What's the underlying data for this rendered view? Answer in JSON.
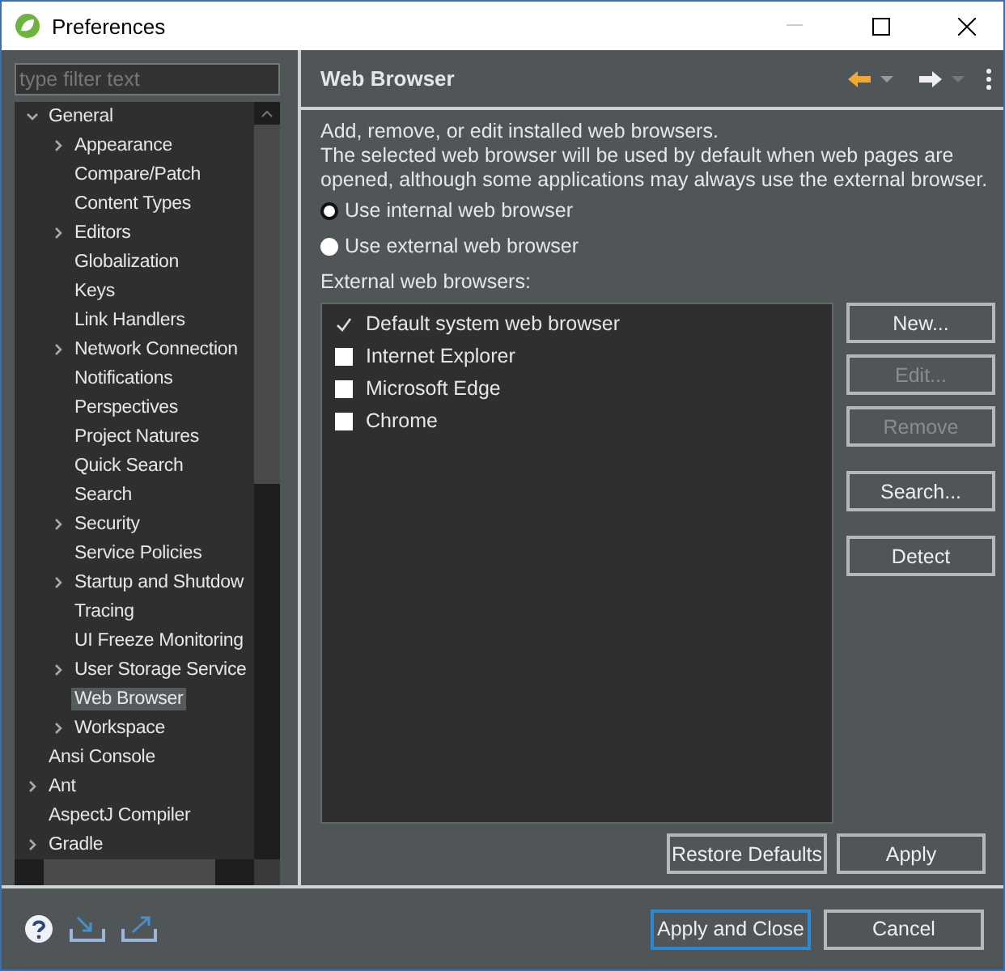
{
  "window": {
    "title": "Preferences"
  },
  "filter": {
    "placeholder": "type filter text"
  },
  "tree": [
    {
      "label": "General",
      "expanded": true,
      "selected": false,
      "children": [
        {
          "label": "Appearance",
          "expanded": false,
          "selected": false
        },
        {
          "label": "Compare/Patch",
          "selected": false
        },
        {
          "label": "Content Types",
          "selected": false
        },
        {
          "label": "Editors",
          "expanded": false,
          "selected": false
        },
        {
          "label": "Globalization",
          "selected": false
        },
        {
          "label": "Keys",
          "selected": false
        },
        {
          "label": "Link Handlers",
          "selected": false
        },
        {
          "label": "Network Connection",
          "expanded": false,
          "selected": false
        },
        {
          "label": "Notifications",
          "selected": false
        },
        {
          "label": "Perspectives",
          "selected": false
        },
        {
          "label": "Project Natures",
          "selected": false
        },
        {
          "label": "Quick Search",
          "selected": false
        },
        {
          "label": "Search",
          "selected": false
        },
        {
          "label": "Security",
          "expanded": false,
          "selected": false
        },
        {
          "label": "Service Policies",
          "selected": false
        },
        {
          "label": "Startup and Shutdow",
          "expanded": false,
          "selected": false
        },
        {
          "label": "Tracing",
          "selected": false
        },
        {
          "label": "UI Freeze Monitoring",
          "selected": false
        },
        {
          "label": "User Storage Service",
          "expanded": false,
          "selected": false
        },
        {
          "label": "Web Browser",
          "selected": true
        },
        {
          "label": "Workspace",
          "expanded": false,
          "selected": false
        }
      ]
    },
    {
      "label": "Ansi Console",
      "selected": false
    },
    {
      "label": "Ant",
      "expanded": false,
      "selected": false
    },
    {
      "label": "AspectJ Compiler",
      "selected": false
    },
    {
      "label": "Gradle",
      "expanded": false,
      "selected": false
    }
  ],
  "page": {
    "title": "Web Browser",
    "description": [
      "Add, remove, or edit installed web browsers.",
      "The selected web browser will be used by default when web pages are opened, although some applications may always use the external browser."
    ],
    "radios": [
      {
        "label": "Use internal web browser",
        "selected": true
      },
      {
        "label": "Use external web browser",
        "selected": false
      }
    ],
    "list_label": "External web browsers:",
    "browsers": [
      {
        "name": "Default system web browser",
        "checked": true
      },
      {
        "name": "Internet Explorer",
        "checked": false
      },
      {
        "name": "Microsoft Edge",
        "checked": false
      },
      {
        "name": "Chrome",
        "checked": false
      }
    ],
    "side_buttons": [
      {
        "label": "New...",
        "disabled": false
      },
      {
        "label": "Edit...",
        "disabled": true
      },
      {
        "label": "Remove",
        "disabled": true
      },
      {
        "label": "Search...",
        "disabled": false
      },
      {
        "label": "Detect",
        "disabled": false
      }
    ],
    "restore_button": "Restore Defaults",
    "apply_button": "Apply"
  },
  "footer": {
    "buttons": [
      {
        "label": "Apply and Close",
        "selected": true
      },
      {
        "label": "Cancel",
        "selected": false
      }
    ]
  }
}
